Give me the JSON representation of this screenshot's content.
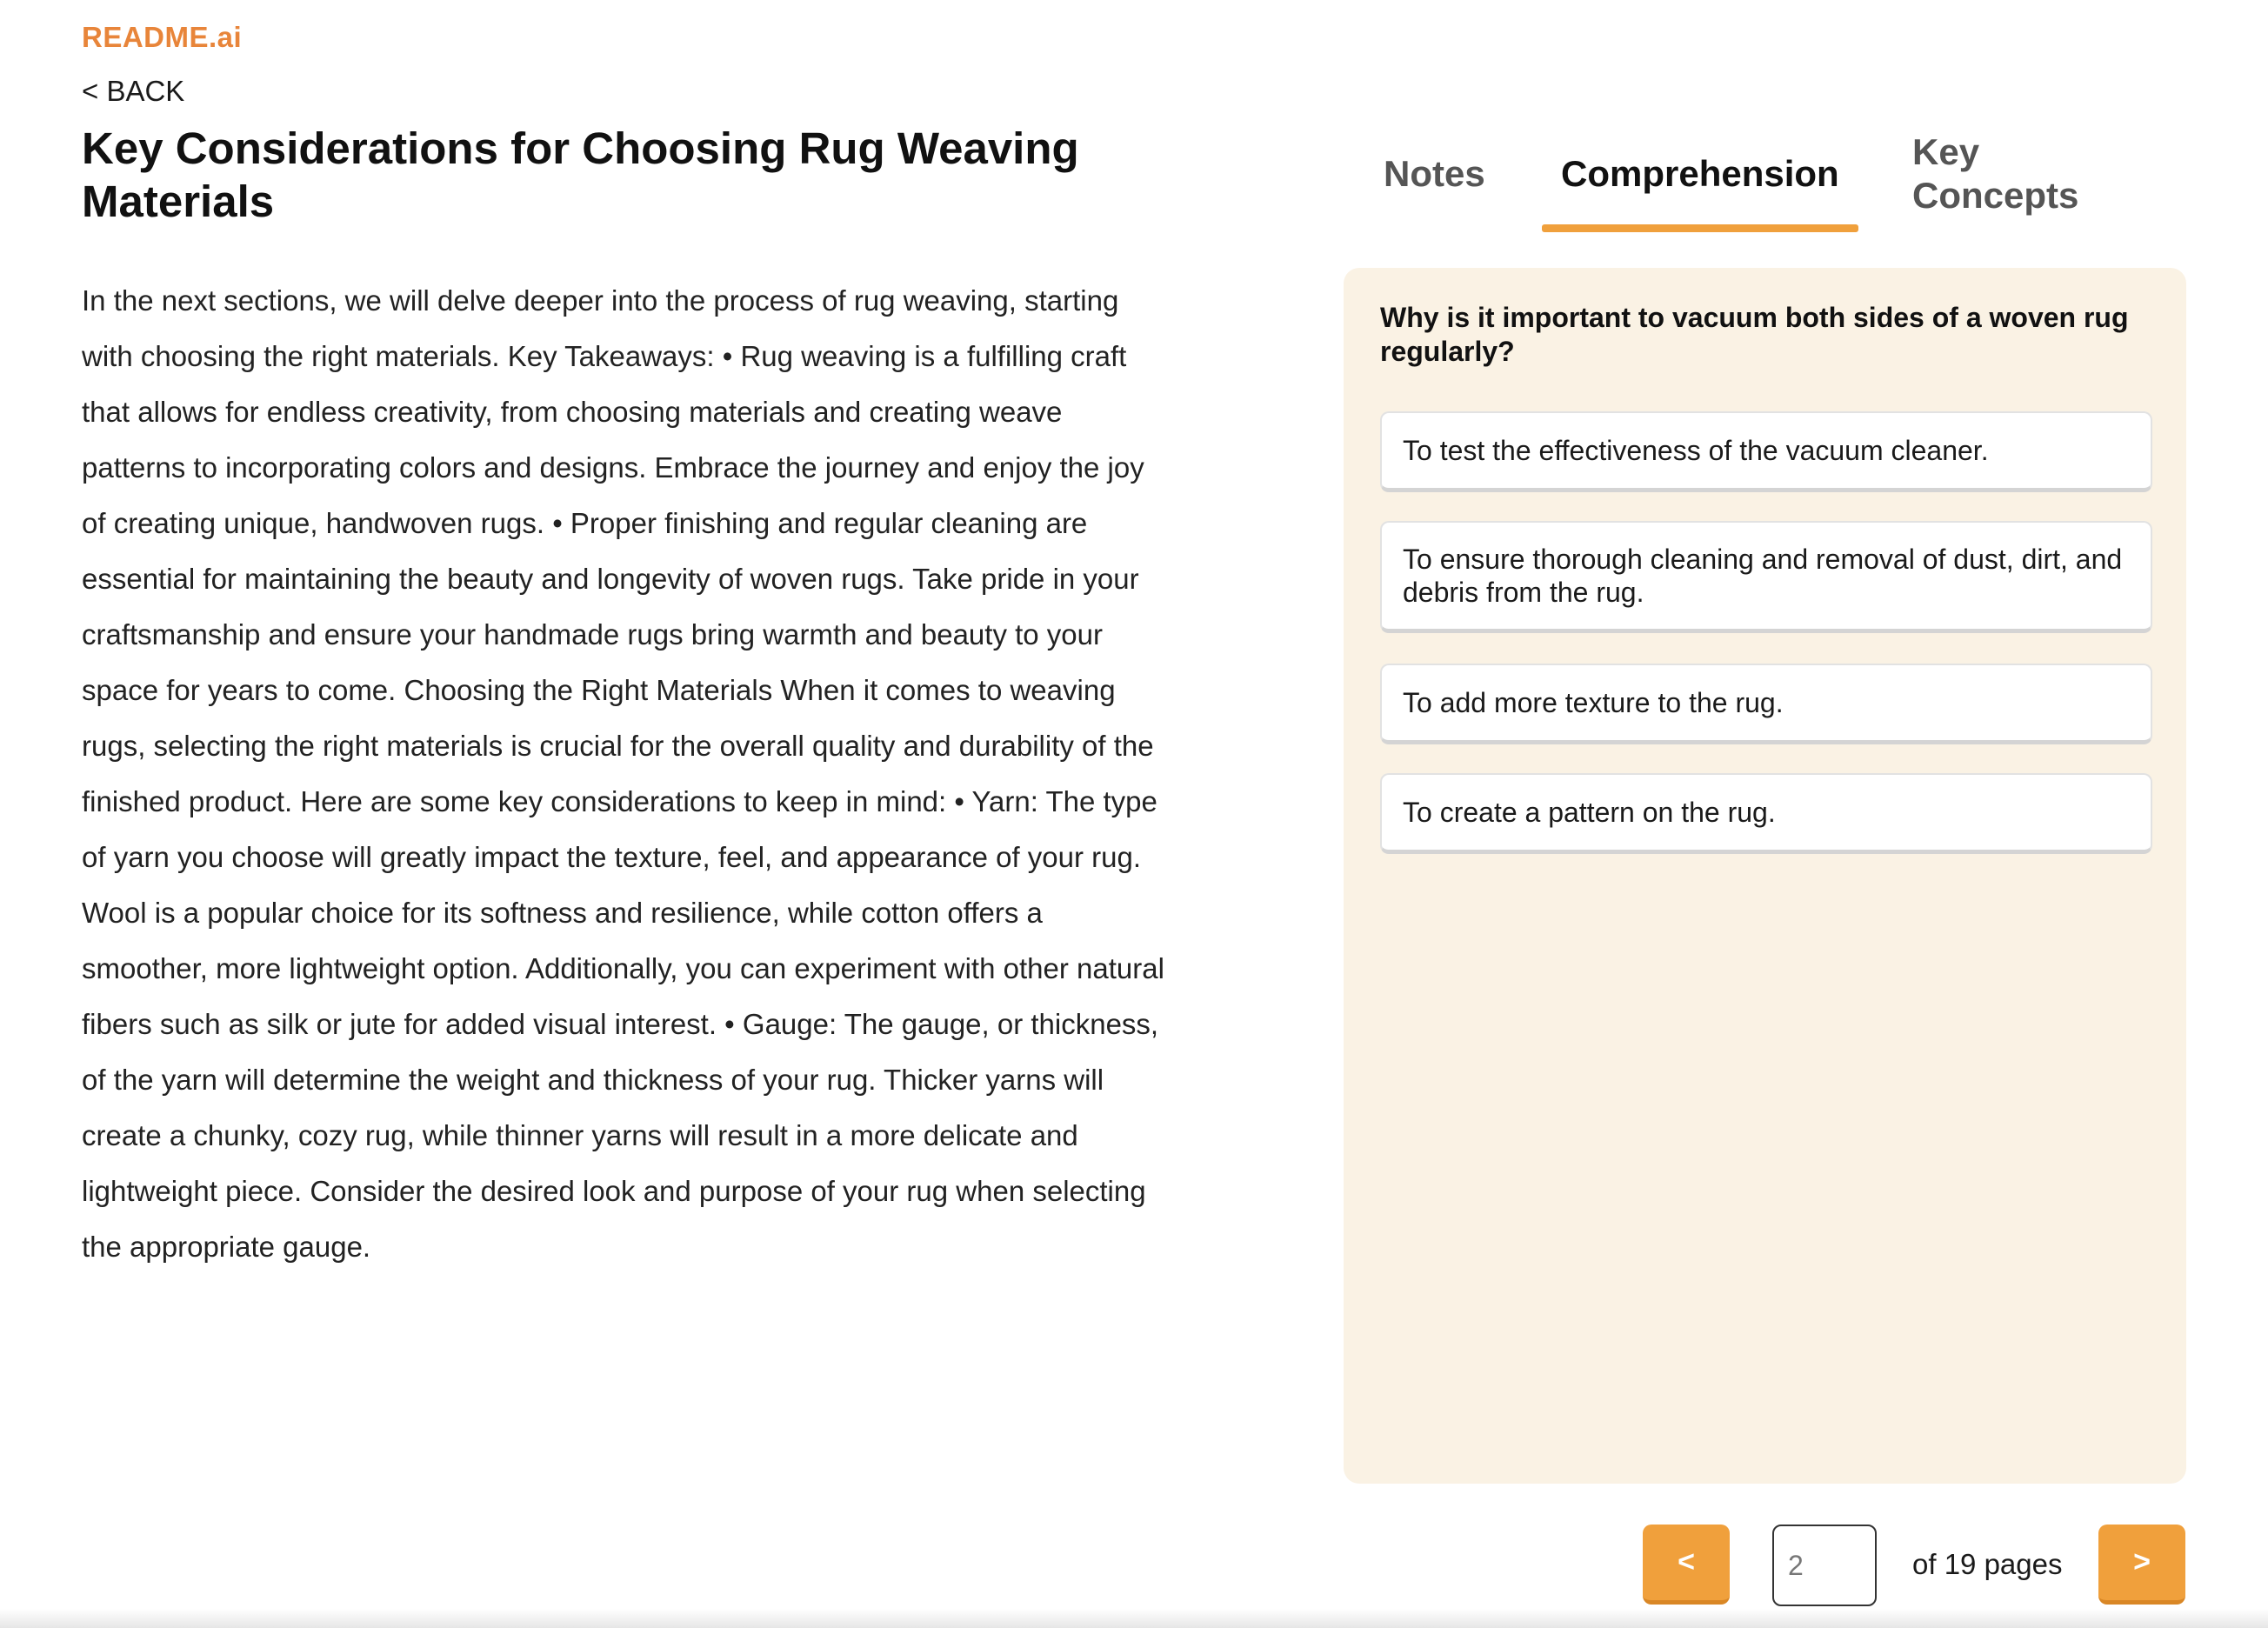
{
  "header": {
    "brand": "README.ai",
    "back_label": "< BACK"
  },
  "article": {
    "title": "Key Considerations for Choosing Rug Weaving Materials",
    "body": "In the next sections, we will delve deeper into the process of rug weaving, starting with choosing the right materials. Key Takeaways: • Rug weaving is a fulfilling craft that allows for endless creativity, from choosing materials and creating weave patterns to incorporating colors and designs. Embrace the journey and enjoy the joy of creating unique, handwoven rugs. • Proper finishing and regular cleaning are essential for maintaining the beauty and longevity of woven rugs. Take pride in your craftsmanship and ensure your handmade rugs bring warmth and beauty to your space for years to come. Choosing the Right Materials When it comes to weaving rugs, selecting the right materials is crucial for the overall quality and durability of the finished product. Here are some key considerations to keep in mind: • Yarn: The type of yarn you choose will greatly impact the texture, feel, and appearance of your rug. Wool is a popular choice for its softness and resilience, while cotton offers a smoother, more lightweight option. Additionally, you can experiment with other natural fibers such as silk or jute for added visual interest. • Gauge: The gauge, or thickness, of the yarn will determine the weight and thickness of your rug. Thicker yarns will create a chunky, cozy rug, while thinner yarns will result in a more delicate and lightweight piece. Consider the desired look and purpose of your rug when selecting the appropriate gauge."
  },
  "tabs": {
    "notes": "Notes",
    "comprehension": "Comprehension",
    "key_concepts": "Key Concepts",
    "active": "comprehension"
  },
  "quiz": {
    "question": "Why is it important to vacuum both sides of a woven rug regularly?",
    "options": [
      "To test the effectiveness of the vacuum cleaner.",
      "To ensure thorough cleaning and removal of dust, dirt, and debris from the rug.",
      "To add more texture to the rug.",
      "To create a pattern on the rug."
    ]
  },
  "pager": {
    "prev_label": "<",
    "next_label": ">",
    "current_page": "2",
    "total_label": "of 19 pages"
  },
  "colors": {
    "brand": "#e8853a",
    "accent": "#f0a03c",
    "panel_bg": "#faf2e4"
  }
}
